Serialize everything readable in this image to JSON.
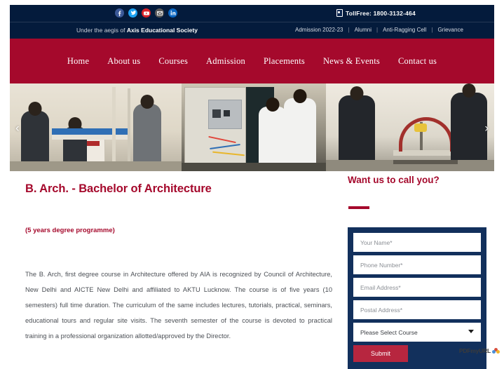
{
  "topbar": {
    "social": [
      {
        "name": "facebook-icon",
        "glyph": "f"
      },
      {
        "name": "twitter-icon",
        "glyph": "t"
      },
      {
        "name": "youtube-icon",
        "glyph": "▶"
      },
      {
        "name": "email-icon",
        "glyph": "✉"
      },
      {
        "name": "linkedin-icon",
        "glyph": "in"
      }
    ],
    "tollfree_label": "TollFree: 1800-3132-464",
    "aegis_prefix": "Under the aegis of ",
    "aegis_strong": "Axis Educational Society",
    "links": [
      {
        "label": "Admission 2022-23"
      },
      {
        "label": "Alumni"
      },
      {
        "label": "Anti-Ragging Cell"
      },
      {
        "label": "Grievance"
      }
    ],
    "separator": "|",
    "bg_color": "#041b3c"
  },
  "nav": {
    "bg_color": "#a5092c",
    "items": [
      {
        "label": "Home"
      },
      {
        "label": "About us"
      },
      {
        "label": "Courses"
      },
      {
        "label": "Admission"
      },
      {
        "label": "Placements"
      },
      {
        "label": "News & Events"
      },
      {
        "label": "Contact us"
      }
    ]
  },
  "hero": {
    "prev_arrow": "‹",
    "next_arrow": "›",
    "slides": [
      {
        "caption": "students-operating-lab-equipment"
      },
      {
        "caption": "students-at-electrical-control-panel"
      },
      {
        "caption": "students-testing-arch-structure"
      }
    ]
  },
  "main": {
    "title": "B. Arch. - Bachelor of Architecture",
    "subtitle": "(5 years degree programme)",
    "paragraph": "The B. Arch, first degree course in Architecture offered by AIA is recognized by Council of Architecture, New Delhi and AICTE New Delhi and affiliated to AKTU Lucknow. The course is of five years (10 semesters) full time duration. The curriculum of the same includes lectures, tutorials, practical, seminars, educational tours and regular site visits. The seventh semester of the course is devoted to practical training in a professional organization allotted/approved by the Director.",
    "accent_color": "#a5092c"
  },
  "callback_form": {
    "heading": "Want us to call you?",
    "box_color": "#12305c",
    "fields": [
      {
        "name": "your-name",
        "placeholder": "Your Name*",
        "value": ""
      },
      {
        "name": "phone-number",
        "placeholder": "Phone Number*",
        "value": ""
      },
      {
        "name": "email-address",
        "placeholder": "Email Address*",
        "value": ""
      },
      {
        "name": "postal-address",
        "placeholder": "Postal Address*",
        "value": ""
      }
    ],
    "course_select": {
      "selected": "Please Select Course",
      "options": [
        "Please Select Course"
      ]
    },
    "submit_label": "Submit"
  },
  "watermark": {
    "text": "PDFmyURL"
  }
}
